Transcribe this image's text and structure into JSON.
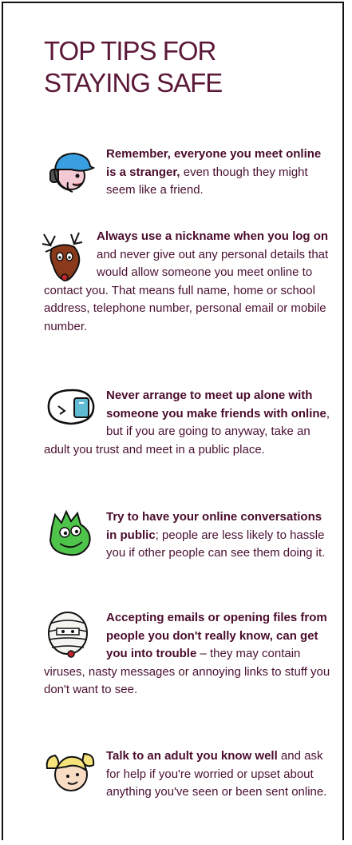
{
  "title": {
    "line1": "TOP TIPS FOR",
    "line2": "STAYING SAFE"
  },
  "tips": [
    {
      "bold": "Remember, everyone you meet online is a stranger,",
      "rest": " even though they might seem like a friend.",
      "icon": "cap-character-icon"
    },
    {
      "bold": "Always use a nickname when you log on",
      "rest": " and never give out any personal details that would allow someone you meet online to contact you. That means full name, home or school address, telephone number, personal email or mobile number.",
      "icon": "reindeer-icon"
    },
    {
      "bold": "Never arrange to meet up alone with someone you make friends with online",
      "rest": ", but if you are going to anyway, take an adult you trust and meet in a public place.",
      "icon": "computer-character-icon"
    },
    {
      "bold": "Try to have your online conversations in public",
      "rest": "; people are less likely to hassle you if other people can see them doing it.",
      "icon": "green-monster-icon"
    },
    {
      "bold": "Accepting emails or opening files from people you don't really know, can get you into trouble",
      "rest": " – they may contain viruses, nasty messages or annoying links to stuff you don't want to see.",
      "icon": "mummy-icon"
    },
    {
      "bold": "Talk to an adult you know well",
      "rest": " and ask for help if you're worried or upset about anything you've seen or been sent online.",
      "icon": "girl-pigtails-icon"
    }
  ]
}
